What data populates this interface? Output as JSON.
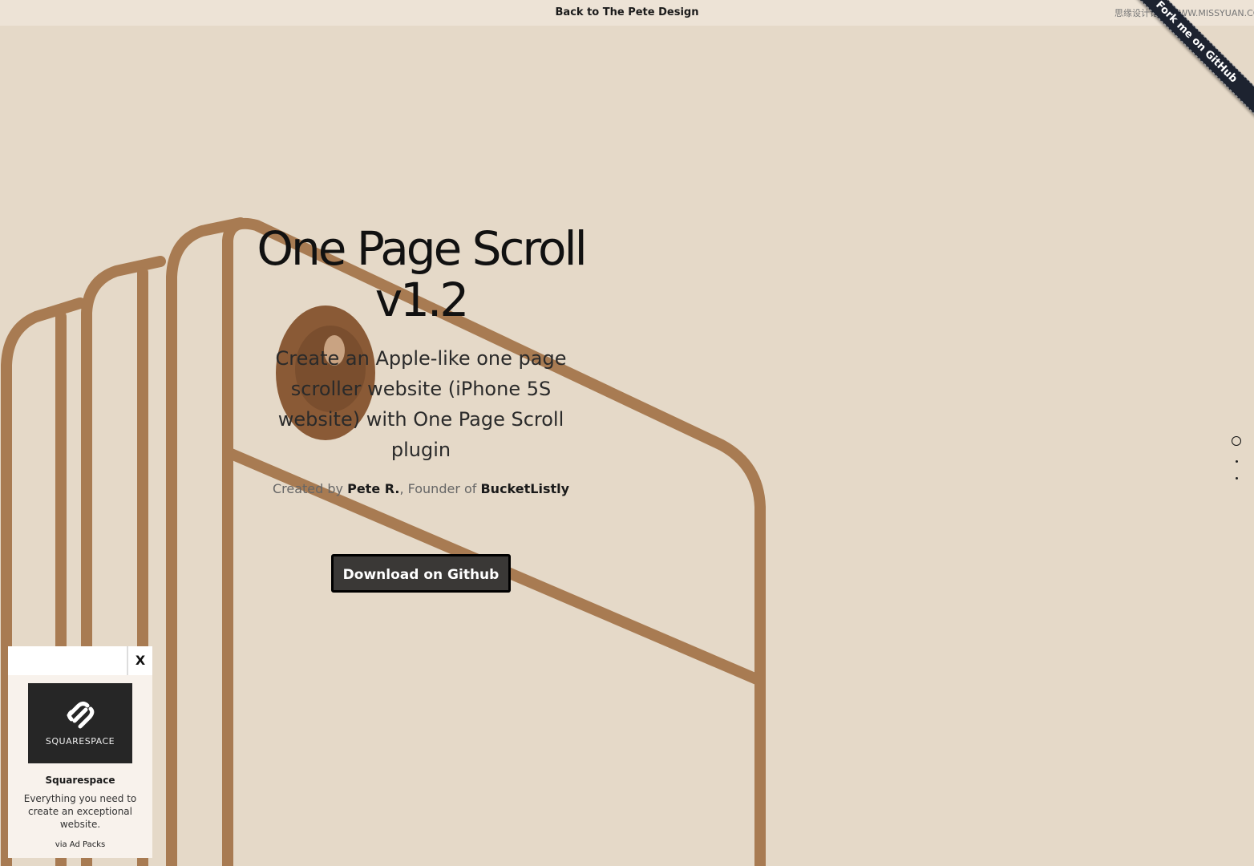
{
  "topbar": {
    "back_link": "Back to The Pete Design",
    "watermark": "思缘设计论坛 WWW.MISSYUAN.COM"
  },
  "ribbon": {
    "label": "Fork me on GitHub"
  },
  "hero": {
    "title": "One Page Scroll v1.2",
    "subtitle": "Create an Apple-like one page scroller website (iPhone 5S website) with One Page Scroll plugin",
    "credits_prefix": "Created by ",
    "author": "Pete R.",
    "credits_middle": ", Founder of ",
    "company": "BucketListly",
    "download_button": "Download on Github"
  },
  "pager": {
    "items": [
      "page-1",
      "page-2",
      "page-3"
    ],
    "active_index": 0
  },
  "ad": {
    "close_label": "X",
    "logo_text": "SQUARESPACE",
    "title": "Squarespace",
    "description": "Everything you need to create an exceptional website.",
    "via": "via Ad Packs"
  },
  "colors": {
    "background": "#e5d9c8",
    "topbar": "#ede3d6",
    "phone_outline": "#a87b52",
    "camera": "#8a5a36",
    "button": "#3a3836",
    "ribbon": "#1d2330"
  },
  "icons": {
    "ad_logo": "squarespace-logo-icon",
    "camera": "camera-lens-icon"
  }
}
